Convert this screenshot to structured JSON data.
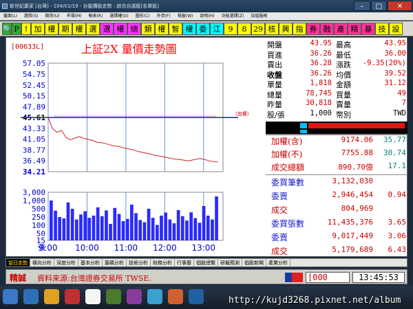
{
  "window": {
    "title": "新世紀贏家 [台灣] - 104/01/19 - 台盤價股走勢 : 綜合自選股[名單股]",
    "min": "–",
    "max": "□",
    "close": "✕"
  },
  "menu": [
    "盤面(L)",
    "證券(S)",
    "期貨(U)",
    "市場(M)",
    "報表(R)",
    "選擇權(O)",
    "圖形(C)",
    "外資(F)",
    "視窗(W)",
    "說明(H)",
    "功能選擇(Z)",
    "加值服務"
  ],
  "toolbar": [
    {
      "label": "🔍",
      "bg": "#33aa33",
      "w": 14
    },
    {
      "label": "P",
      "bg": "#33aa33",
      "w": 14
    },
    {
      "label": "↑",
      "bg": "#ffff00",
      "w": 14
    },
    {
      "label": "加",
      "bg": "#ffff00",
      "w": 20
    },
    {
      "label": "權",
      "bg": "#ffff00",
      "w": 20
    },
    {
      "label": "期",
      "bg": "#ffff00",
      "w": 20
    },
    {
      "label": "權",
      "bg": "#ffff00",
      "w": 20
    },
    {
      "label": "選",
      "bg": "#ffff00",
      "w": 20
    },
    {
      "label": "選",
      "bg": "#ff33ff",
      "w": 20
    },
    {
      "label": "權",
      "bg": "#ff33ff",
      "w": 20
    },
    {
      "label": "總",
      "bg": "#ff33ff",
      "w": 20
    },
    {
      "label": "類",
      "bg": "#ffff00",
      "w": 20
    },
    {
      "label": "權",
      "bg": "#ffff00",
      "w": 20
    },
    {
      "label": "智",
      "bg": "#ffff00",
      "w": 20
    },
    {
      "label": "權",
      "bg": "#00ffff",
      "w": 20
    },
    {
      "label": "委",
      "bg": "#00ffff",
      "w": 20
    },
    {
      "label": "江",
      "bg": "#00ffff",
      "w": 20
    },
    {
      "label": "9",
      "bg": "#ffff00",
      "w": 20
    },
    {
      "label": "8",
      "bg": "#ffff00",
      "w": 20
    },
    {
      "label": "29",
      "bg": "#ffff00",
      "w": 20
    },
    {
      "label": "核",
      "bg": "#ffff00",
      "w": 20
    },
    {
      "label": "興",
      "bg": "#ffff00",
      "w": 20
    },
    {
      "label": "指",
      "bg": "#ffff00",
      "w": 20
    },
    {
      "label": "券",
      "bg": "#ff3399",
      "w": 20
    },
    {
      "label": "融",
      "bg": "#ff3399",
      "w": 20
    },
    {
      "label": "產",
      "bg": "#ff3399",
      "w": 20
    },
    {
      "label": "精",
      "bg": "#ff3399",
      "w": 20
    },
    {
      "label": "基",
      "bg": "#ff3399",
      "w": 20
    },
    {
      "label": "技",
      "bg": "#ffff00",
      "w": 20
    },
    {
      "label": "設",
      "bg": "#ffff00",
      "w": 20
    }
  ],
  "stock": {
    "code": "[00633L]",
    "name": "上証2X 量價走勢圖",
    "addweight_tag": "(加權)"
  },
  "price_axis": [
    "57.05",
    "54.75",
    "52.45",
    "50.15",
    "47.89",
    "45.61",
    "43.33",
    "41.05",
    "38.77",
    "36.49",
    "34.21"
  ],
  "volume_axis": [
    "3,000",
    "1,000",
    "500",
    "250",
    "100",
    "50",
    "15",
    "張"
  ],
  "time_axis": [
    "9:00",
    "10:00",
    "11:00",
    "12:00",
    "13:00"
  ],
  "quote": [
    {
      "l1": "開盤",
      "v1": "43.95",
      "l2": "最高",
      "v2": "43.95"
    },
    {
      "l1": "買進",
      "v1": "36.26",
      "l2": "最低",
      "v2": "36.00"
    },
    {
      "l1": "賣出",
      "v1": "36.28",
      "l2": "漲跌",
      "v2": "-9.35(20%)"
    },
    {
      "l1": "收盤",
      "v1": "36.26",
      "l2": "均價",
      "v2": "39.52"
    },
    {
      "l1": "單量",
      "v1": "1,818",
      "l2": "金額",
      "v2": "31.12"
    },
    {
      "l1": "總量",
      "v1": "78,745",
      "l2": "買量",
      "v2": "49"
    },
    {
      "l1": "昨量",
      "v1": "30,818",
      "l2": "賣量",
      "v2": "7"
    },
    {
      "l1": "股/張",
      "v1": "1,000",
      "l2": "幣別",
      "v2": "TWD"
    }
  ],
  "index": [
    {
      "label": "加權(含)",
      "value": "9174.06",
      "change": "35.77"
    },
    {
      "label": "加權(不)",
      "value": "7755.88",
      "change": "30.74"
    },
    {
      "label": "成交總額",
      "value": "890.70億",
      "change": "17.1"
    }
  ],
  "orders": [
    {
      "label": "委買筆數",
      "value": "3,132,030",
      "ratio": ""
    },
    {
      "label": "委賣",
      "value": "2,946,454",
      "ratio": "0.94"
    },
    {
      "label": "成交",
      "value": "804,969",
      "ratio": ""
    },
    {
      "label": "委買張數",
      "value": "11,435,376",
      "ratio": "3.65"
    },
    {
      "label": "委賣",
      "value": "9,017,449",
      "ratio": "3.06"
    },
    {
      "label": "成交",
      "value": "5,179,689",
      "ratio": "6.43"
    }
  ],
  "tabs": [
    "當日走勢",
    "橫向分析",
    "深度分析",
    "基本分析",
    "籌碼分析",
    "技術分析",
    "財務分析",
    "行事曆",
    "個股總覽",
    "研報預測",
    "個股新聞",
    "產業分析"
  ],
  "status": {
    "label": "精誠",
    "source": "資料來源:台灣證券交易所 TWSE.",
    "code_field": "[000",
    "time": "13:45:53"
  },
  "watermark": "http://kujd3268.pixnet.net/album",
  "chart_data": {
    "type": "line",
    "x_label_ticks": [
      "9:00",
      "10:00",
      "11:00",
      "12:00",
      "13:00"
    ],
    "ylim": [
      34.21,
      57.05
    ],
    "reference_price": 45.61,
    "series": [
      {
        "values": [
          45.61,
          43.2,
          42.5,
          42.9,
          41.4,
          40.9,
          41.3,
          41.6,
          41.2,
          41.0,
          40.8,
          40.4,
          40.3,
          40.1,
          39.8,
          39.6,
          39.5,
          39.2,
          39.0,
          38.8,
          38.5,
          38.3,
          38.1,
          37.9,
          37.6,
          37.5,
          37.3,
          37.1,
          36.9,
          36.8,
          36.7,
          36.5,
          36.6,
          36.8,
          37.0,
          36.8,
          36.5,
          36.3,
          36.26
        ]
      }
    ],
    "volume_values": [
      1450,
      1080,
      850,
      800,
      1380,
      1150,
      760,
      940,
      1060,
      820,
      900,
      1200,
      880,
      1090,
      600,
      1180,
      960,
      700,
      780,
      1300,
      990,
      740,
      660,
      1150,
      820,
      560,
      900,
      1010,
      760,
      620,
      1100,
      880,
      720,
      1020,
      810,
      640,
      1250,
      900,
      760,
      1600
    ]
  }
}
